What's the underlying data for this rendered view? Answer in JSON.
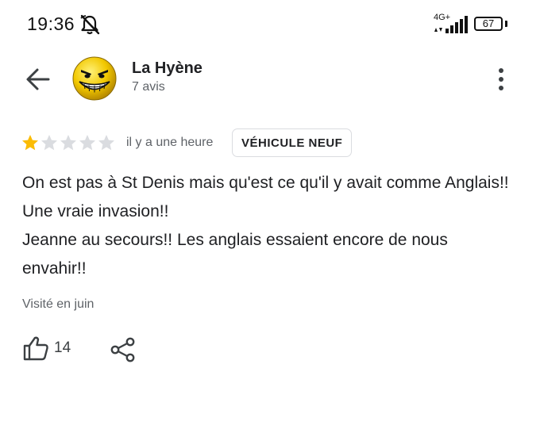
{
  "status_bar": {
    "time": "19:36",
    "mute_icon": "notifications-off-icon",
    "network": "4G+",
    "battery": "67"
  },
  "header": {
    "user_name": "La Hyène",
    "review_count": "7 avis",
    "avatar_icon": "evil-grin-smiley-icon",
    "back_icon": "arrow-left-icon",
    "menu_icon": "more-vert-icon"
  },
  "review": {
    "rating": 1,
    "max_rating": 5,
    "time_ago": "il y a une heure",
    "tag": "VÉHICULE NEUF",
    "paragraphs": [
      "On est pas à St Denis mais qu'est ce qu'il y avait comme Anglais!! Une vraie invasion!!",
      "Jeanne au secours!! Les anglais essaient encore de nous envahir!!"
    ],
    "visited": "Visité en juin"
  },
  "actions": {
    "like_count": "14",
    "like_icon": "thumb-up-icon",
    "share_icon": "share-icon"
  },
  "colors": {
    "star_filled": "#fbbc04",
    "star_empty": "#dadce0",
    "text_primary": "#202124",
    "text_secondary": "#5f6368"
  }
}
